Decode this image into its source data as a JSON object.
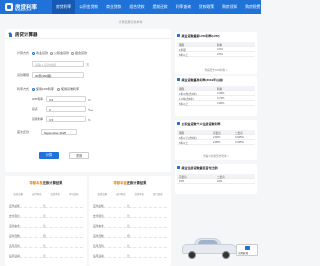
{
  "header": {
    "logo_name": "房贷利率",
    "logo_sub": "fangdailiv.com",
    "nav": [
      "房贷利率",
      "公积金贷款",
      "商业贷款",
      "组合贷款",
      "提前还款",
      "利率查询",
      "贷款政策",
      "购房须知",
      "购房税费"
    ],
    "nav_active": 0
  },
  "breadcrumb": "计算结果仅供参考",
  "calculator": {
    "title": "房贷计算器",
    "loan_type": {
      "label": "计算方式",
      "options": [
        "商业贷款",
        "公积金贷款",
        "组合贷款"
      ],
      "selected": 0
    },
    "amount_placeholder": "请输入贷款金额",
    "amount_unit": "万",
    "term": {
      "label": "贷款期限",
      "value": "30年(360期)"
    },
    "rate_mode": {
      "label": "利率方式",
      "options": [
        "使用LPR利率",
        "使用基准利率"
      ],
      "selected": 0
    },
    "lpr": {
      "label": "LPR利率",
      "value": "3.5",
      "unit": "%"
    },
    "basis": {
      "label": "基点",
      "value": "0",
      "unit": "‱"
    },
    "rate": {
      "label": "贷款利率",
      "value": "3.5",
      "unit": "%"
    },
    "first_pay": {
      "label": "首次还款",
      "value": "September 2025"
    },
    "calc_button": "计算",
    "reset_button": "重置"
  },
  "sidebar": {
    "lpr": {
      "title": "商业贷款最新LPR利率(LPR)",
      "header": [
        "期限",
        "利率"
      ],
      "rows": [
        [
          "1年期",
          "3.0%"
        ],
        [
          "5年以上",
          "3.5%"
        ]
      ],
      "more": "查看历史LPR利率 >"
    },
    "base": {
      "title": "商业贷款基准利率(2019年以前)",
      "header": [
        "期限",
        "利率"
      ],
      "rows": [
        [
          "1年以内(含1年)",
          "4.35%"
        ],
        [
          "1-5年(含5年)",
          "4.75%"
        ],
        [
          "5年以上",
          "4.90%"
        ]
      ]
    },
    "fund": {
      "title": "公积金贷款个人住房贷款利率",
      "header": [
        "期限",
        "首套房",
        "二套房"
      ],
      "rows": [
        [
          "5年以下(含5年)",
          "2.60%",
          "3.025%"
        ],
        [
          "5年以上",
          "2.85%",
          "3.325%"
        ]
      ],
      "more": "查看公积金历史利率 >"
    },
    "policy": {
      "title": "商业住房贷款最低首付比例",
      "header": [
        "首套房",
        "二套房"
      ],
      "rows": [
        [
          "15%",
          "15%"
        ]
      ]
    },
    "ad_badge": "东风轩逸"
  },
  "results": {
    "left": {
      "hl": "等额本息",
      "rest": "还款计算结果",
      "stats": [
        "还款总额",
        "支付利息",
        "贷款本金",
        "月均还款"
      ],
      "rows": [
        {
          "k": "还款总额",
          "v": "元"
        },
        {
          "k": "支付利息",
          "v": "元"
        },
        {
          "k": "贷款本金",
          "v": "元"
        },
        {
          "k": "贷款月数",
          "v": "月"
        },
        {
          "k": "首月月供",
          "v": "元"
        },
        {
          "k": "每月递减",
          "v": "元"
        }
      ]
    },
    "right": {
      "hl": "等额本金",
      "rest": "还款计算结果",
      "stats": [
        "还款总额",
        "支付利息",
        "贷款本金",
        "首月还款"
      ],
      "rows": [
        {
          "k": "还款总额",
          "v": "元"
        },
        {
          "k": "支付利息",
          "v": "元"
        },
        {
          "k": "贷款本金",
          "v": "元"
        },
        {
          "k": "贷款月数",
          "v": "月"
        },
        {
          "k": "首月月供",
          "v": "元"
        },
        {
          "k": "每月递减",
          "v": "元"
        }
      ]
    }
  },
  "colors": {
    "brand": "#1e72d8",
    "highlight": "#f08300"
  }
}
